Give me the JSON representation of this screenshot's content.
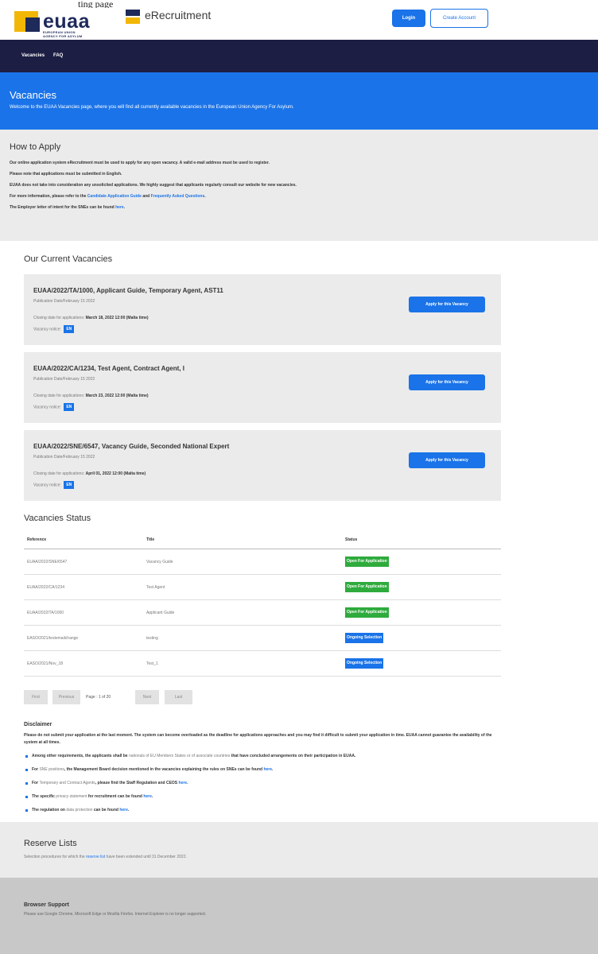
{
  "top_text": "ting page",
  "brand": {
    "logo_word": "euaa",
    "logo_sub1": "EUROPEAN UNION",
    "logo_sub2": "AGENCY FOR ASYLUM",
    "app_name": "eRecruitment"
  },
  "auth": {
    "login": "Login",
    "create": "Create Account"
  },
  "nav": {
    "vacancies": "Vacancies",
    "faq": "FAQ"
  },
  "hero": {
    "title": "Vacancies",
    "text": "Welcome to the EUAA Vacancies page, where you will find all currently available vacancies in the European Union Agency For Asylum."
  },
  "howto": {
    "title": "How to Apply",
    "p1": "Our online application system eRecruitment must be used to apply for any open vacancy. A valid e-mail address must be used to register.",
    "p2": "Please note that applications must be submitted in English.",
    "p3": "EUAA does not take into consideration any unsolicited applications. We highly suggest that applicants regularly consult our website for new vacancies.",
    "p4_pre": "For more information, please refer to the ",
    "p4_link1": "Candidate Application Guide",
    "p4_mid": " and ",
    "p4_link2": "Frequently Asked Questions",
    "p4_post": ".",
    "p5_pre": "The Employer letter of intent for the SNEs can be found ",
    "p5_link": "here",
    "p5_post": "."
  },
  "current": {
    "title": "Our Current Vacancies",
    "closing_label": "Closing date for applications: ",
    "notice_label": "Vacancy notice: ",
    "notice_lang": "EN",
    "apply_label": "Apply for this Vacancy",
    "items": [
      {
        "title": "EUAA/2022/TA/1000, Applicant Guide, Temporary Agent, AST11",
        "pub": "Publication Date/February 15 2022",
        "closing": "March 18, 2022 12:00 (Malta time)"
      },
      {
        "title": "EUAA/2022/CA/1234, Test Agent, Contract Agent, I",
        "pub": "Publication Date/February 15 2022",
        "closing": "March 23, 2022 12:00 (Malta time)"
      },
      {
        "title": "EUAA/2022/SNE/6547, Vacancy Guide, Seconded National Expert",
        "pub": "Publication Date/February 15 2022",
        "closing": "April 01, 2022 12:00 (Malta time)"
      }
    ]
  },
  "status": {
    "title": "Vacancies Status",
    "headers": {
      "reference": "Reference",
      "title": "Title",
      "status": "Status"
    },
    "rows": [
      {
        "reference": "EUAA/2022/SNE/6547",
        "title": "Vacancy Guide",
        "status": "Open For Application",
        "kind": "open"
      },
      {
        "reference": "EUAA/2022/CA/1234",
        "title": "Test Agent",
        "status": "Open For Application",
        "kind": "open"
      },
      {
        "reference": "EUAA/2022/TA/1000",
        "title": "Applicant Guide",
        "status": "Open For Application",
        "kind": "open"
      },
      {
        "reference": "EASO/2021/testemailchange",
        "title": "testing",
        "status": "Ongoing Selection",
        "kind": "ongoing"
      },
      {
        "reference": "EASO/2021/Nov_18",
        "title": "Test_1",
        "status": "Ongoing Selection",
        "kind": "ongoing"
      }
    ],
    "colors": {
      "open": "#2eab3c",
      "ongoing": "#1a73e8"
    }
  },
  "pager": {
    "first": "First",
    "previous": "Previous",
    "info": "Page : 1 of 20",
    "next": "Next",
    "last": "Last"
  },
  "disclaimer": {
    "title": "Disclaimer",
    "intro": "Please do not submit your application at the last moment. The system can become overloaded as the deadline for applications approaches and you may find it difficult to submit your application in time. EUAA cannot guarantee the availability of the system at all times.",
    "b1_pre": "Among other requirements, the applicants shall be ",
    "b1_gray": "nationals of EU Members States or of associate countries",
    "b1_post": " that have concluded arrangements on their participation in EUAA.",
    "b2_pre": "For ",
    "b2_gray": "SNE positions",
    "b2_mid": ", the Management Board decision mentioned in the vacancies explaining the rules on SNEs can be found ",
    "b2_link": "here",
    "b2_post": ".",
    "b3_pre": "For ",
    "b3_gray": "Temporary and Contract Agents",
    "b3_mid": ", please find the Staff Regulation and CEOS ",
    "b3_link": "here",
    "b3_post": ".",
    "b4_pre": "The specific ",
    "b4_gray": "privacy statement",
    "b4_mid": " for recruitment can be found ",
    "b4_link": "here",
    "b4_post": ".",
    "b5_pre": "The regulation on ",
    "b5_gray": "data protection",
    "b5_mid": " can be found ",
    "b5_link": "here",
    "b5_post": "."
  },
  "reserve": {
    "title": "Reserve Lists",
    "text_pre": "Selection procedures for which the ",
    "text_link": "reserve list",
    "text_post": " have been extended until 31 December 2022."
  },
  "browser": {
    "title": "Browser Support",
    "text": "Please use Google Chrome, Microsoft Edge or Mozilla Firefox. Internet Explorer is no longer supported."
  },
  "theme": {
    "accent": "#1a73e8",
    "nav_bg": "#1c1e44",
    "brand_yellow": "#f2b705",
    "brand_navy": "#1e2a5a"
  }
}
